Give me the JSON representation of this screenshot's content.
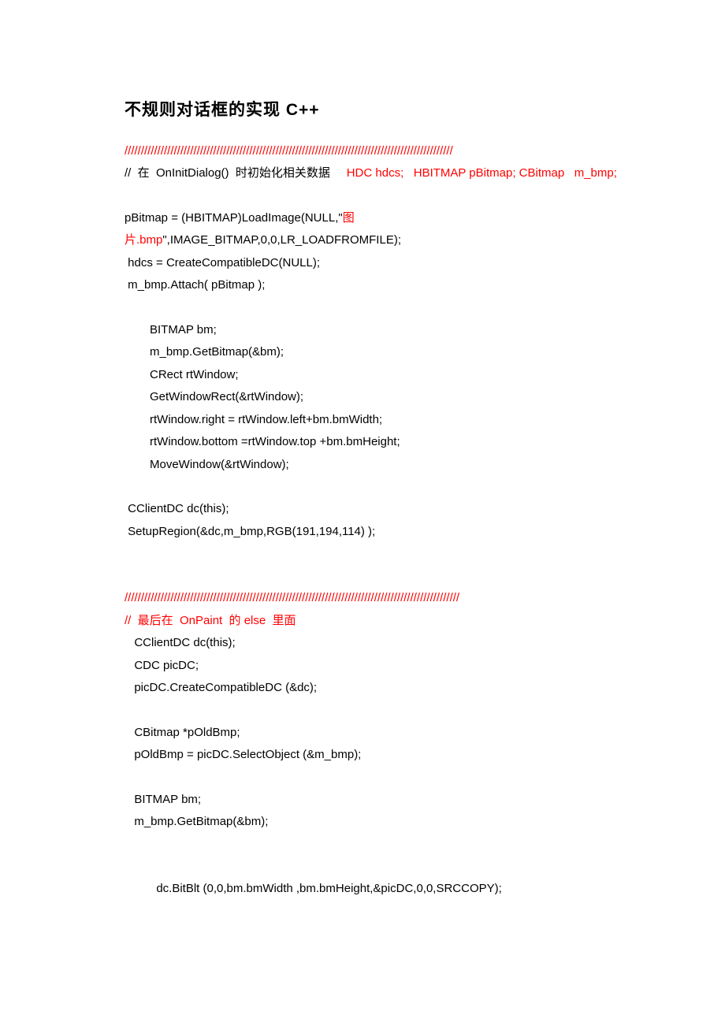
{
  "title": "不规则对话框的实现  C++",
  "sep": "////////////////////////////////////////////////////////////////////////////////////////////////////",
  "l1": {
    "a": "//  在  OnInitDialog()  时初始化相关数据     ",
    "b": "HDC hdcs;   HBITMAP pBitmap; CBitmap   m_bmp;"
  },
  "l2": {
    "a": "pBitmap = (HBITMAP)LoadImage(NULL,\"",
    "b": "图"
  },
  "l3": {
    "a": "片.bmp",
    "b": "\",IMAGE_BITMAP,0,0,LR_LOADFROMFILE);"
  },
  "l4": " hdcs = CreateCompatibleDC(NULL);",
  "l5": " m_bmp.Attach( pBitmap );",
  "l6": "BITMAP bm;",
  "l7": "m_bmp.GetBitmap(&bm);",
  "l8": "CRect rtWindow;",
  "l9": "GetWindowRect(&rtWindow);",
  "l10": "rtWindow.right = rtWindow.left+bm.bmWidth;",
  "l11": "rtWindow.bottom =rtWindow.top +bm.bmHeight;",
  "l12": "MoveWindow(&rtWindow);",
  "l13": " CClientDC dc(this);",
  "l14": " SetupRegion(&dc,m_bmp,RGB(191,194,114) );",
  "sep2": "//////////////////////////////////////////////////////////////////////////////////////////////////////",
  "l15": {
    "a": "//  ",
    "b": "最后在  OnPaint  的 else  里面"
  },
  "l16": "  CClientDC dc(this);",
  "l17": "  CDC picDC;",
  "l18": "  picDC.CreateCompatibleDC (&dc);",
  "l19": "  CBitmap *pOldBmp;",
  "l20": "  pOldBmp = picDC.SelectObject (&m_bmp);",
  "l21": "  BITMAP bm;",
  "l22": "  m_bmp.GetBitmap(&bm);",
  "l23": "  dc.BitBlt (0,0,bm.bmWidth ,bm.bmHeight,&picDC,0,0,SRCCOPY);"
}
